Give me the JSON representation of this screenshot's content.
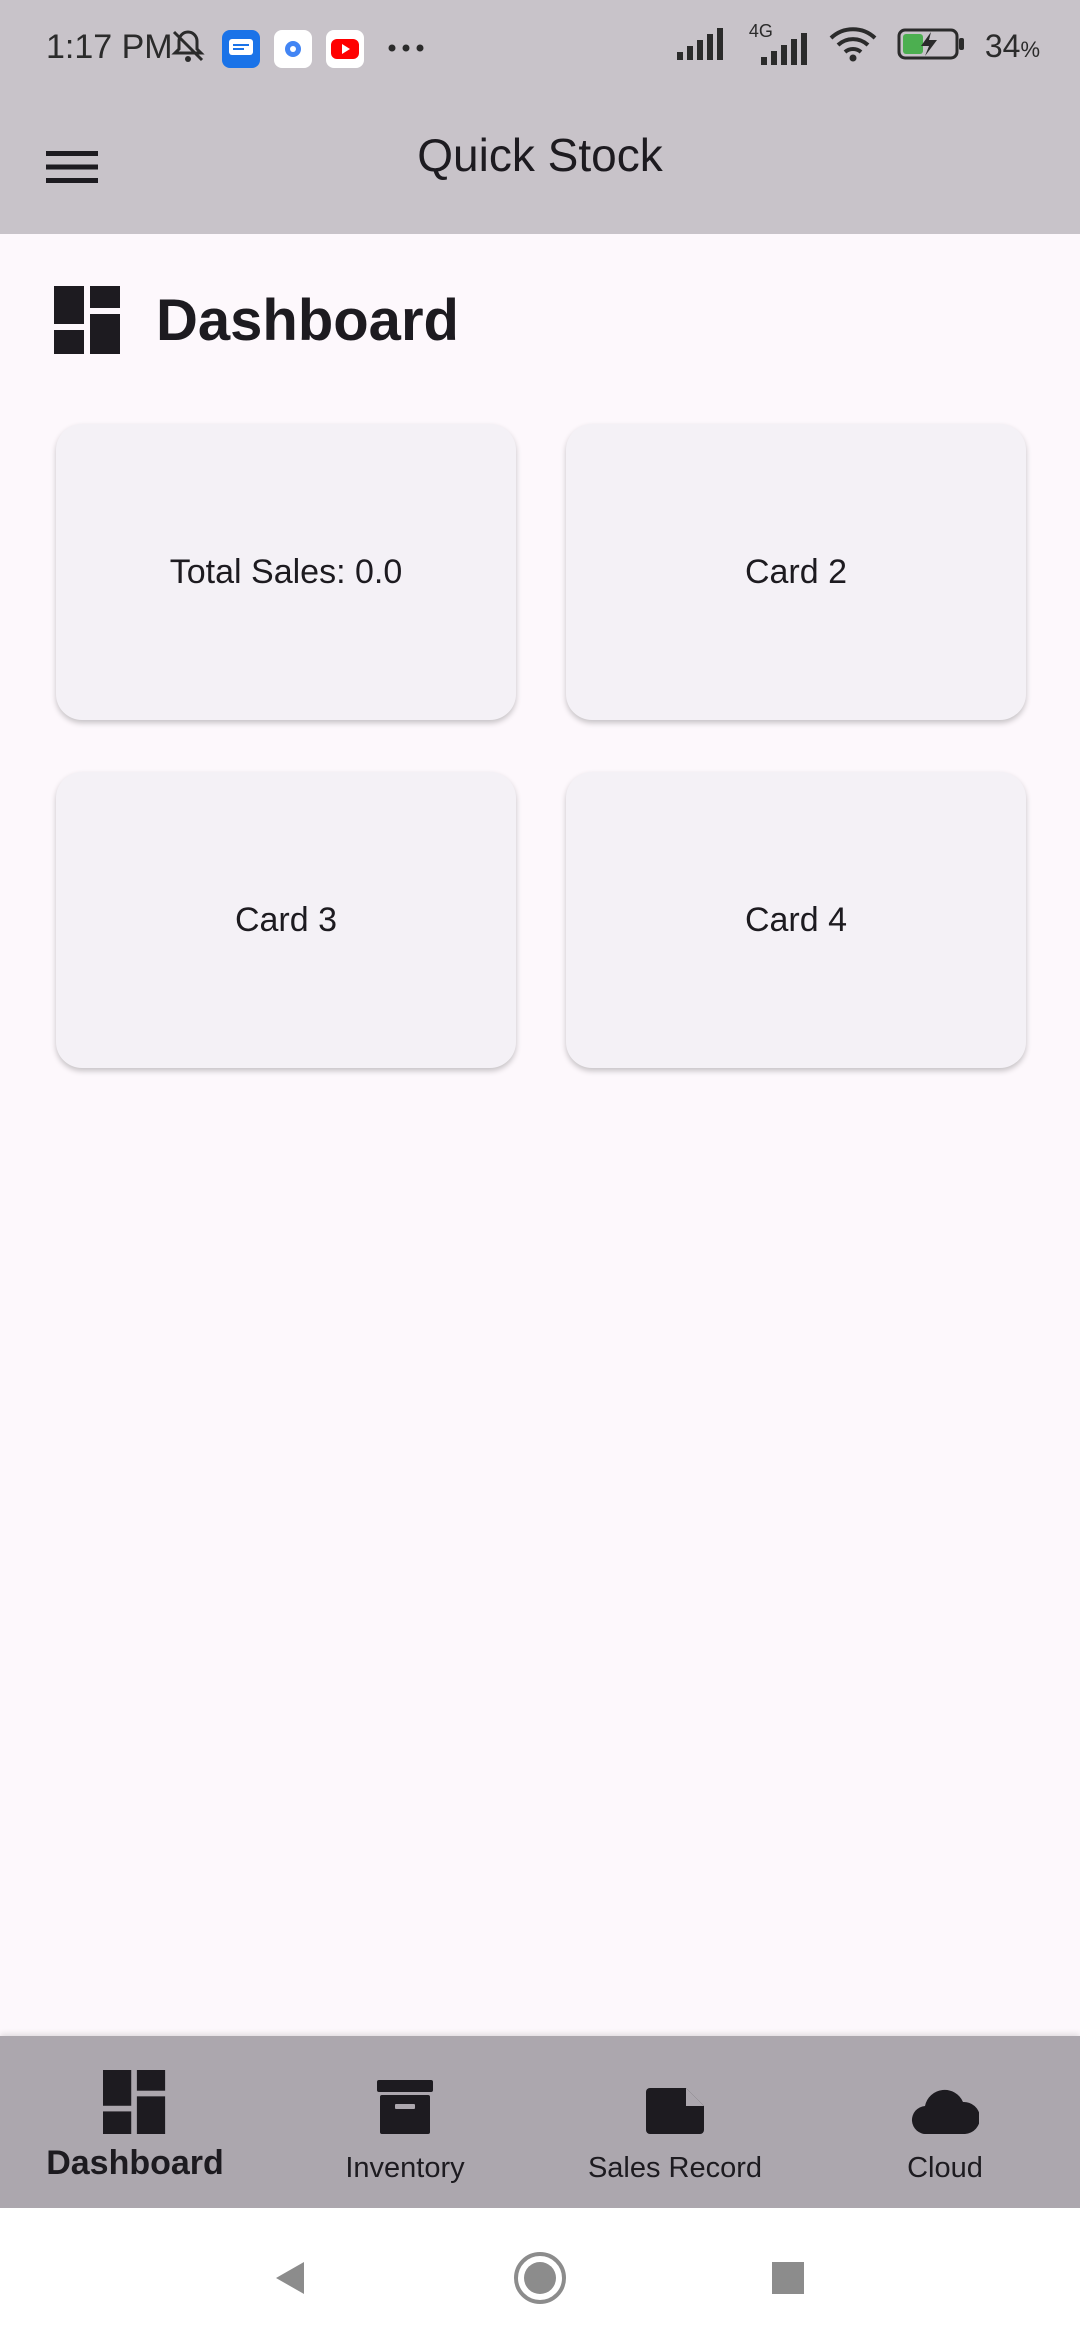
{
  "status_bar": {
    "time": "1:17 PM",
    "network_label": "4G",
    "battery": "34",
    "battery_unit": "%",
    "icons": [
      "mute-icon",
      "message-icon",
      "settings-app-icon",
      "youtube-icon",
      "more-dots-icon",
      "signal-icon",
      "wifi-icon",
      "battery-charging-icon"
    ]
  },
  "app_bar": {
    "title": "Quick Stock",
    "menu_icon": "hamburger-menu-icon"
  },
  "page": {
    "title": "Dashboard",
    "icon": "dashboard-icon"
  },
  "cards": [
    {
      "label": "Total Sales: 0.0"
    },
    {
      "label": "Card 2"
    },
    {
      "label": "Card 3"
    },
    {
      "label": "Card 4"
    }
  ],
  "bottom_nav": {
    "items": [
      {
        "label": "Dashboard",
        "icon": "dashboard-icon",
        "active": true
      },
      {
        "label": "Inventory",
        "icon": "archive-icon",
        "active": false
      },
      {
        "label": "Sales Record",
        "icon": "note-icon",
        "active": false
      },
      {
        "label": "Cloud",
        "icon": "cloud-icon",
        "active": false
      }
    ]
  },
  "colors": {
    "app_bar_bg": "#c8c3c9",
    "bottom_nav_bg": "#aca7ae",
    "card_bg": "#f4f1f6",
    "page_bg": "#fdf8fc"
  }
}
